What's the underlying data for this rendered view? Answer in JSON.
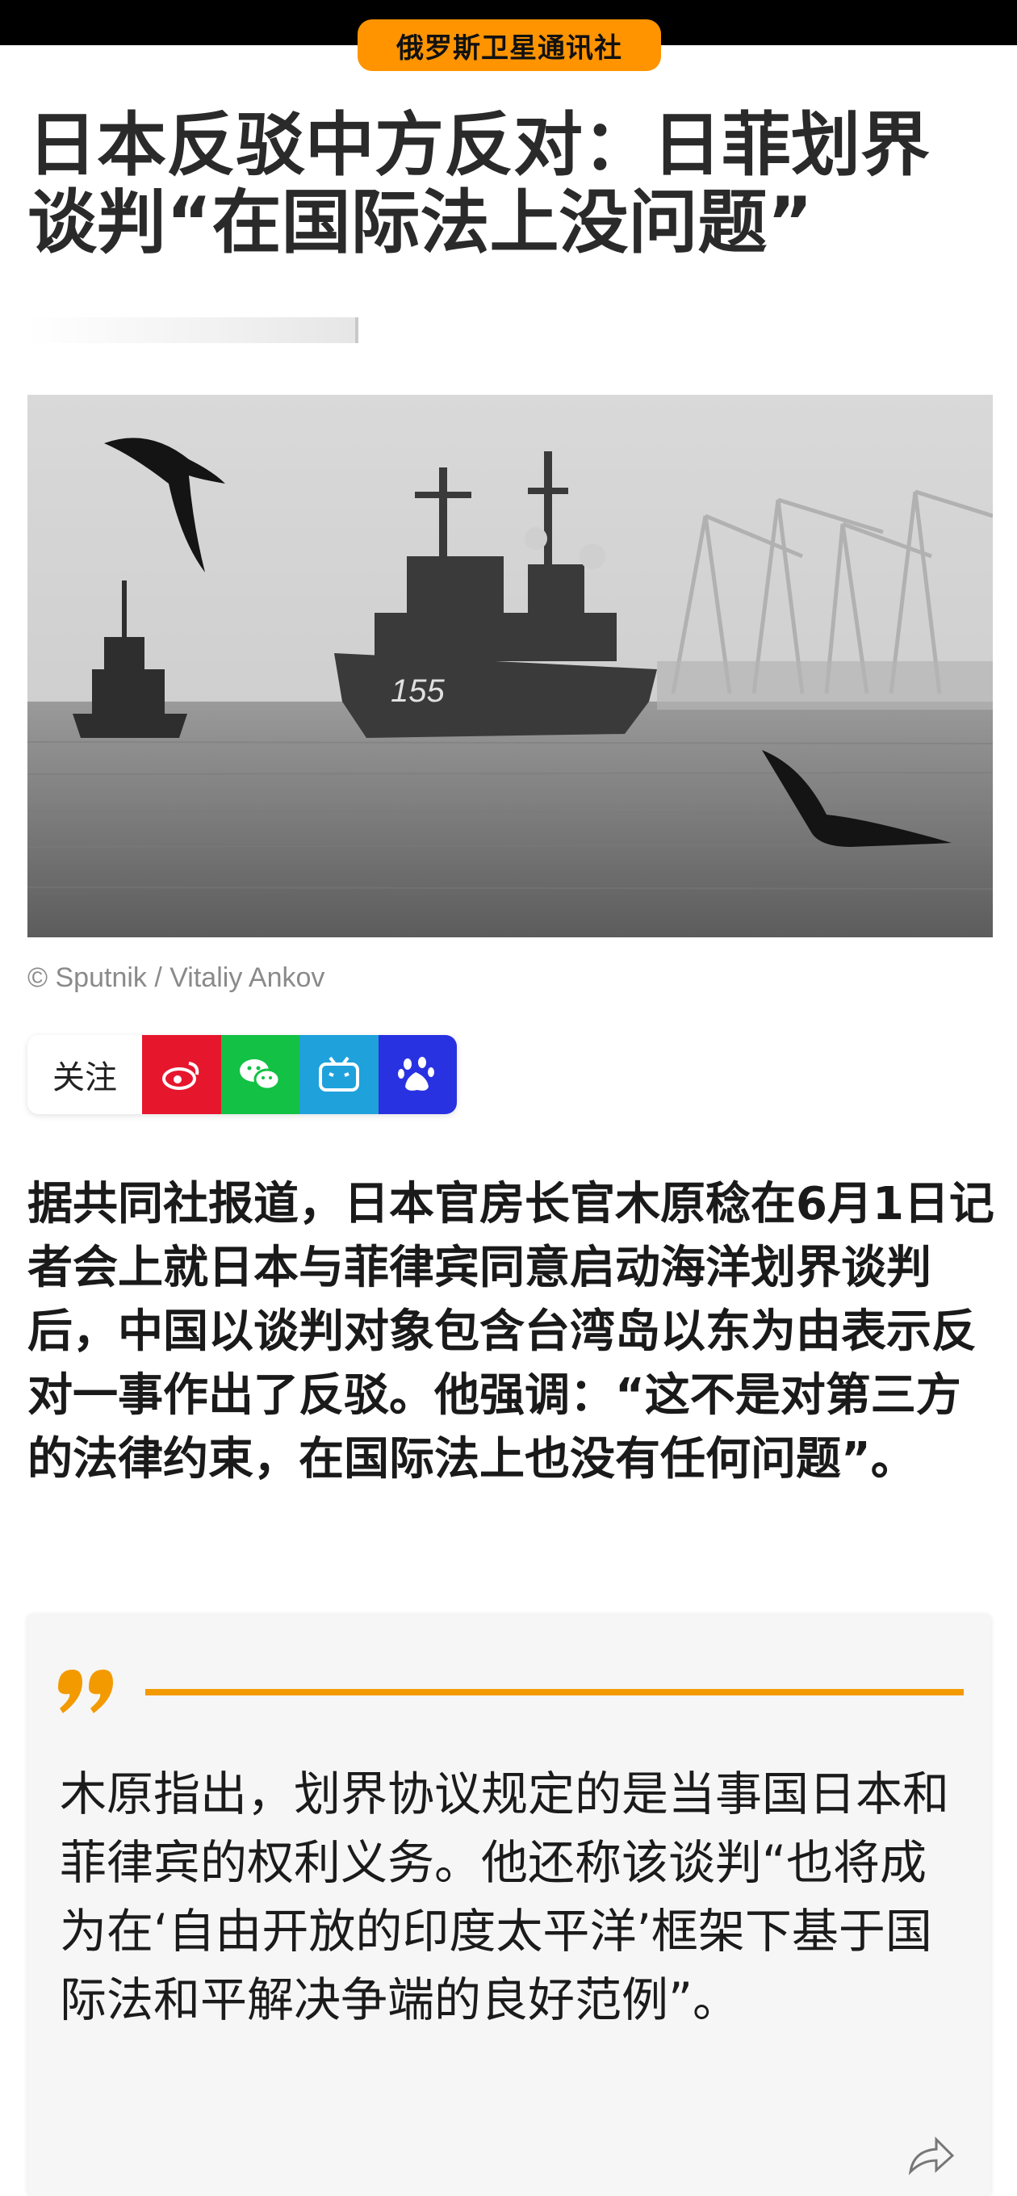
{
  "header": {
    "brand": "俄罗斯卫星通讯社"
  },
  "article": {
    "title": "日本反驳中方反对：日菲划界谈判“在国际法上没问题”",
    "photo_credit": "© Sputnik / Vitaliy Ankov",
    "lead": "据共同社报道，日本官房长官木原稔在6月1日记者会上就日本与菲律宾同意启动海洋划界谈判后，中国以谈判对象包含台湾岛以东为由表示反对一事作出了反驳。他强调：“这不是对第三方的法律约束，在国际法上也没有任何问题”。",
    "quote": "木原指出，划界协议规定的是当事国日本和菲律宾的权利义务。他还称该谈判“也将成为在‘自由开放的印度太平洋’框架下基于国际法和平解决争端的良好范例”。",
    "ship_hull_number": "155"
  },
  "follow": {
    "label": "关注",
    "icons": [
      "weibo-icon",
      "wechat-icon",
      "bilibili-icon",
      "baidu-icon"
    ]
  },
  "colors": {
    "brand_orange": "#ff9400",
    "quote_accent": "#f39a00",
    "weibo": "#e6162d",
    "wechat": "#13c144",
    "bilibili": "#1fa1dc",
    "baidu": "#2932e1"
  }
}
